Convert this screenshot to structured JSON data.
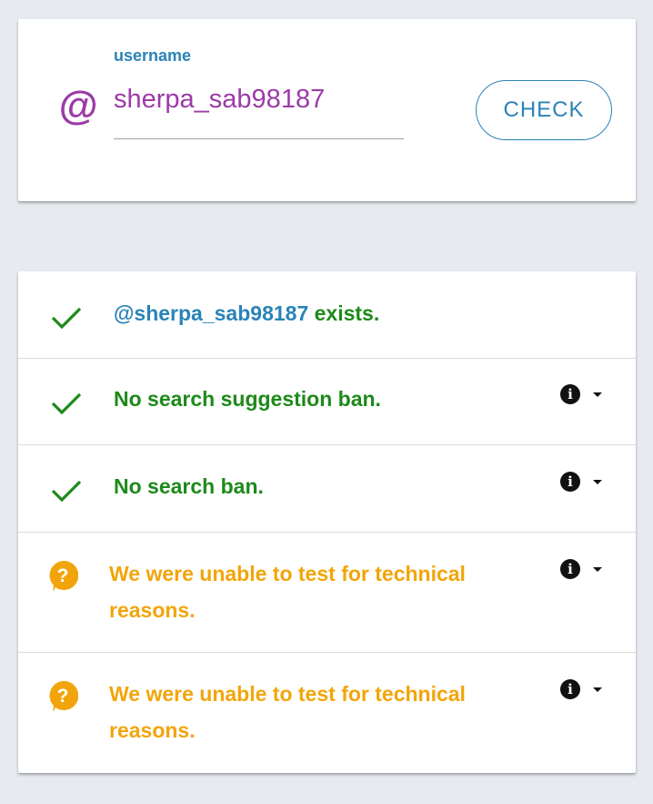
{
  "form": {
    "label": "username",
    "value": "sherpa_sab98187",
    "at_symbol": "@",
    "check_button": "CHECK"
  },
  "results": [
    {
      "status": "ok",
      "user_part": "@sherpa_sab98187",
      "text": " exists.",
      "has_info": false
    },
    {
      "status": "ok",
      "text": "No search suggestion ban.",
      "has_info": true
    },
    {
      "status": "ok",
      "text": "No search ban.",
      "has_info": true
    },
    {
      "status": "unknown",
      "line1": "We were unable to test for technical",
      "line2": "reasons.",
      "has_info": true
    },
    {
      "status": "unknown",
      "line1": "We were unable to test for technical",
      "line2": "reasons.",
      "has_info": true
    }
  ],
  "icons": {
    "ok": "check-icon",
    "unknown": "question-bubble-icon",
    "info": "info-icon",
    "expand": "caret-down-icon"
  },
  "colors": {
    "background": "#e7ebef",
    "accent_purple": "#9c3aa8",
    "accent_blue": "#2a83b7",
    "ok_green": "#1d8a1a",
    "warn_orange": "#f2a50a"
  }
}
